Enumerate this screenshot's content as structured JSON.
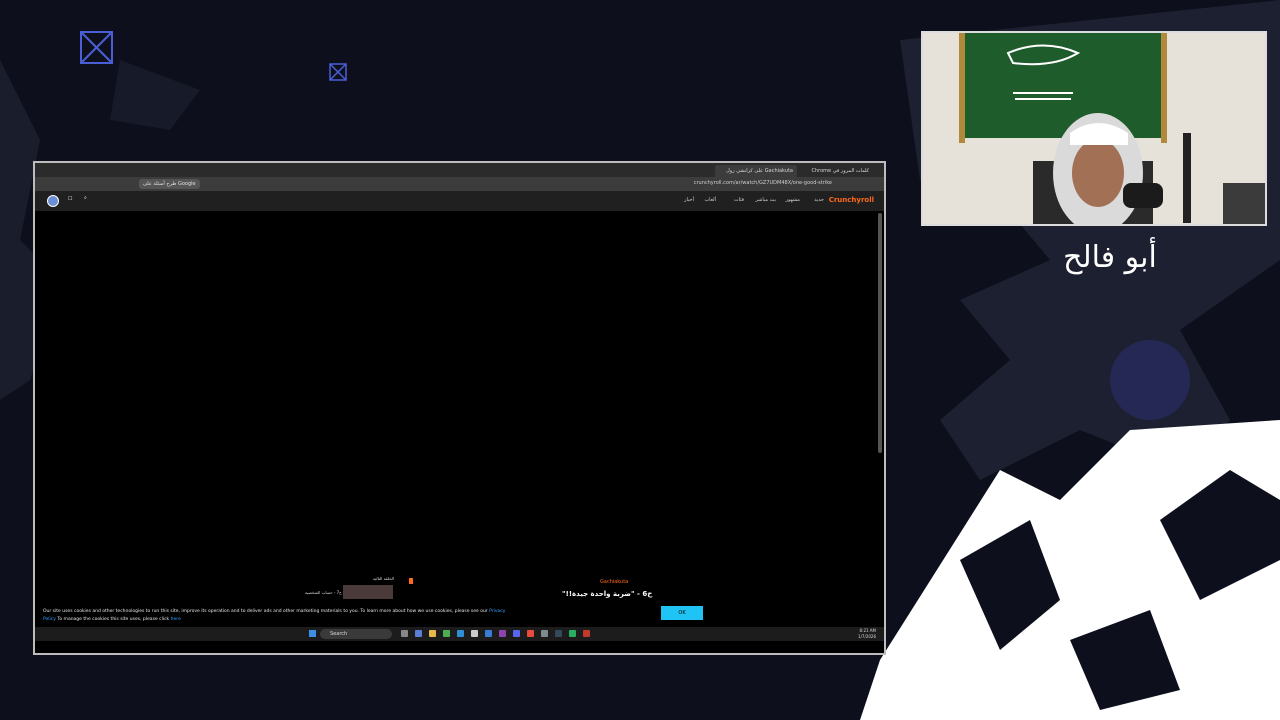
{
  "stream": {
    "streamer_name": "أبو فالح"
  },
  "browser": {
    "tabs": [
      "Gachiakuta على كرانشي رول",
      "كلمات المرور في Chrome"
    ],
    "url": "crunchyroll.com/ar/watch/GZ7UDM48X/one-good-strike",
    "bookmark_label": "طرح أسئلة على Google"
  },
  "site": {
    "brand": "Crunchyroll",
    "nav": [
      "جديد",
      "مشهور",
      "بث مباشر",
      "فئات",
      "ألعاب",
      "أخبار"
    ],
    "series_title": "Gachiakuta",
    "episode_title": "ح6 - \"ضربة واحدة جيدة!!\"",
    "next_episode_heading": "الحلقة التالية",
    "next_episode_title": "ح7 - حساب الشخصية"
  },
  "cookie_banner": {
    "text": "Our site uses cookies and other technologies to run this site, improve its operation and to deliver ads and other marketing materials to you. To learn more about how we use cookies, please see our",
    "policy_link": "Privacy Policy",
    "text2": "To manage the cookies this site uses, please click",
    "here_link": "here",
    "ok_label": "OK"
  },
  "taskbar": {
    "search_label": "Search",
    "time": "8:21 AM",
    "date": "1/7/2026"
  },
  "colors": {
    "background": "#0d0f1c",
    "brand": "#ff6a1a",
    "ok_button": "#20c4f4",
    "flag_green": "#1f5c2c"
  }
}
